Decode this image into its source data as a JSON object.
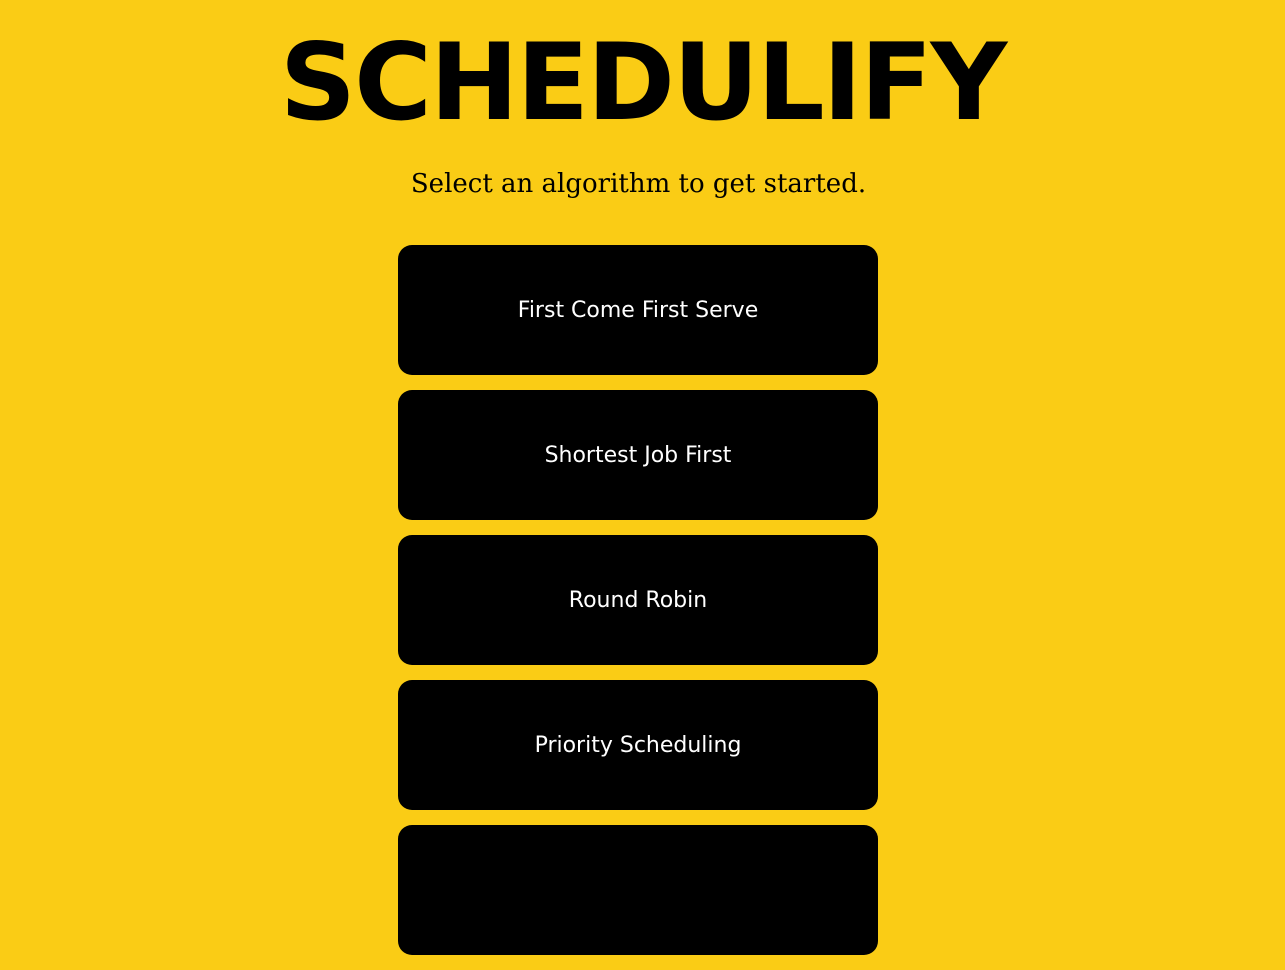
{
  "header": {
    "title": "SCHEDULIFY",
    "subtitle": "Select an algorithm to get started."
  },
  "algorithms": [
    {
      "label": "First Come First Serve"
    },
    {
      "label": "Shortest Job First"
    },
    {
      "label": "Round Robin"
    },
    {
      "label": "Priority Scheduling"
    },
    {
      "label": ""
    }
  ],
  "colors": {
    "background": "#FACC15",
    "button_background": "#000000",
    "button_text": "#FFFFFF",
    "heading_text": "#000000"
  }
}
